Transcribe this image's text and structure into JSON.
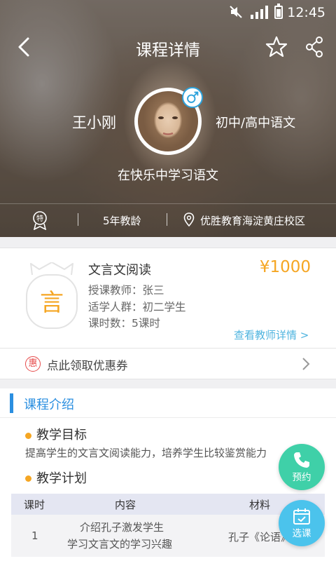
{
  "status_bar": {
    "time": "12:45"
  },
  "nav": {
    "title": "课程详情"
  },
  "teacher": {
    "name": "王小刚",
    "subject": "初中/高中语文",
    "slogan": "在快乐中学习语文",
    "special_badge": "特",
    "teaching_years": "5年教龄",
    "campus": "优胜教育海淀黄庄校区"
  },
  "course": {
    "icon_char": "言",
    "name": "文言文阅读",
    "price": "¥1000",
    "teacher_line": "授课教师：张三",
    "audience_line": "适学人群：初二学生",
    "hours_line": "课时数：5课时",
    "teacher_link": "查看教师详情 >"
  },
  "coupon": {
    "badge": "惠",
    "text": "点此领取优惠券"
  },
  "intro": {
    "title": "课程介绍",
    "goal_title": "教学目标",
    "goal_text": "提高学生的文言文阅读能力，培养学生比较鉴赏能力",
    "plan_title": "教学计划",
    "table": {
      "headers": [
        "课时",
        "内容",
        "材料"
      ],
      "rows": [
        {
          "lesson": "1",
          "content_line1": "介绍孔子激发学生",
          "content_line2": "学习文言文的学习兴趣",
          "material": "孔子《论语》"
        }
      ]
    }
  },
  "actions": {
    "book_label": "预约",
    "select_label": "选课"
  },
  "colors": {
    "accent_blue": "#2b8fe0",
    "price_orange": "#f5a623",
    "book_green": "#3fd0a8",
    "select_blue": "#4bc3ec",
    "coupon_red": "#e64a4a"
  }
}
